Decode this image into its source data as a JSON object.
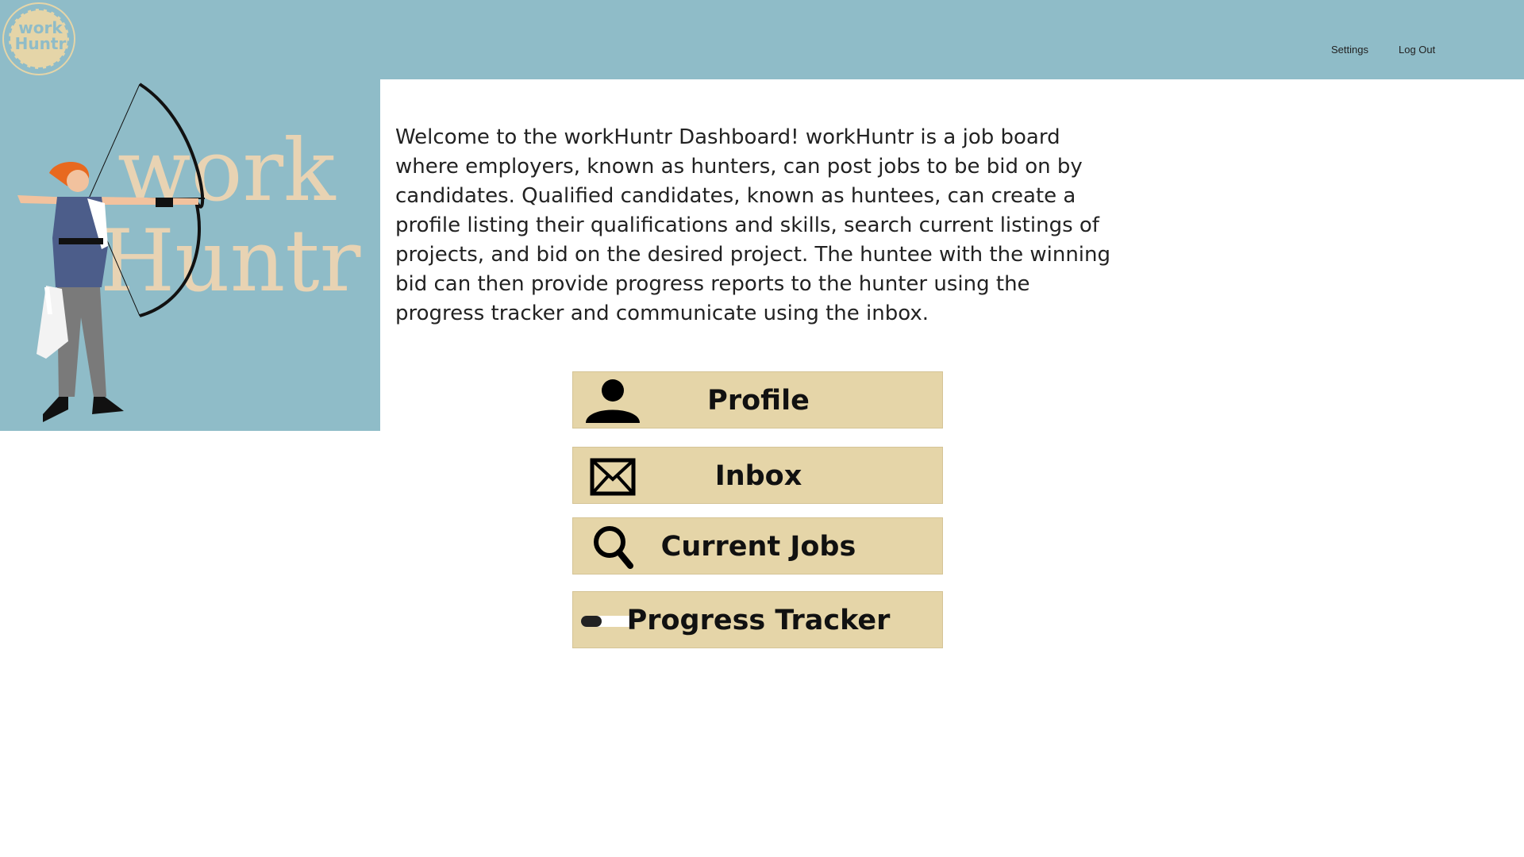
{
  "app": {
    "logo_text_line1": "work",
    "logo_text_line2": "Huntr"
  },
  "header": {
    "nav": [
      {
        "label": "Settings"
      },
      {
        "label": "Log Out"
      }
    ],
    "background_color": "#8fbcc8"
  },
  "hero": {
    "wordmark_line1": "work",
    "wordmark_line2": "Huntr"
  },
  "intro": {
    "text": "Welcome to the workHuntr Dashboard!  workHuntr is a  job board where employers, known as hunters, can post jobs to be bid on by candidates. Qualified candidates, known as huntees, can create a profile listing their qualifications and skills, search current listings of projects, and bid on the desired project.  The huntee with the winning bid can then provide progress reports to the hunter using the progress tracker and communicate using the inbox."
  },
  "buttons": [
    {
      "label": "Profile",
      "icon": "user-icon"
    },
    {
      "label": "Inbox",
      "icon": "envelope-icon"
    },
    {
      "label": "Current Jobs",
      "icon": "search-icon"
    },
    {
      "label": "Progress Tracker",
      "icon": "toggle-icon"
    }
  ],
  "colors": {
    "accent_blue": "#8fbcc8",
    "button_beige": "#e5d5a8"
  }
}
